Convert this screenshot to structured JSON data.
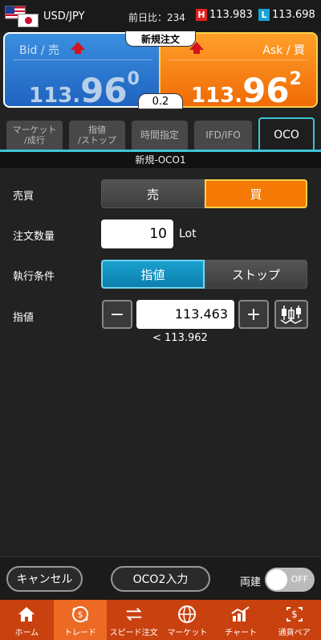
{
  "header": {
    "pair": "USD/JPY",
    "prev_label": "前日比：234",
    "high_tag": "H",
    "high_value": "113.983",
    "low_tag": "L",
    "low_value": "113.698",
    "tag_colors": {
      "high": "#e02020",
      "low": "#17a3d8"
    }
  },
  "quotes": {
    "new_order_label": "新規注文",
    "spread": "0.2",
    "bid": {
      "label": "Bid / 売",
      "price_small": "113.",
      "price_big": "96",
      "price_sup": "0"
    },
    "ask": {
      "label": "Ask / 買",
      "price_small": "113.",
      "price_big": "96",
      "price_sup": "2"
    },
    "colors": {
      "bid": "#2a78d2",
      "ask": "#f57a05"
    }
  },
  "tabs": [
    {
      "label": "マーケット\n/成行",
      "active": false
    },
    {
      "label": "指値\n/ストップ",
      "active": false
    },
    {
      "label": "時間指定",
      "active": false
    },
    {
      "label": "IFD/IFO",
      "active": false
    },
    {
      "label": "OCO",
      "active": true
    }
  ],
  "section_title": "新規-OCO1",
  "form": {
    "side_label": "売買",
    "sell": "売",
    "buy": "買",
    "qty_label": "注文数量",
    "qty_value": "10",
    "qty_unit": "Lot",
    "cond_label": "執行条件",
    "cond_limit": "指値",
    "cond_stop": "ストップ",
    "price_label": "指値",
    "price_value": "113.463",
    "price_hint": "< 113.962"
  },
  "actions": {
    "cancel": "キャンセル",
    "oco2": "OCO2入力",
    "both_label": "両建",
    "toggle_state": "OFF"
  },
  "nav": [
    {
      "label": "ホーム",
      "icon": "home-icon"
    },
    {
      "label": "トレード",
      "icon": "trade-icon",
      "active": true
    },
    {
      "label": "スピード注文",
      "icon": "speed-order-icon"
    },
    {
      "label": "マーケット",
      "icon": "globe-icon"
    },
    {
      "label": "チャート",
      "icon": "chart-icon"
    },
    {
      "label": "通貨ペア",
      "icon": "currency-pair-icon"
    }
  ]
}
